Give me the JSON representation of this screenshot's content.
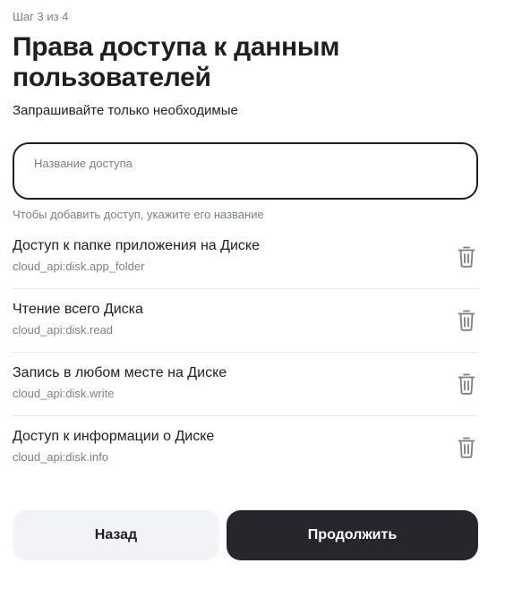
{
  "header": {
    "step": "Шаг 3 из 4",
    "title": "Права доступа к данным пользователей",
    "subtitle": "Запрашивайте только необходимые"
  },
  "access_input": {
    "value": "",
    "placeholder": "Название доступа",
    "hint": "Чтобы добавить доступ, укажите его название"
  },
  "permissions": [
    {
      "title": "Доступ к папке приложения на Диске",
      "scope": "cloud_api:disk.app_folder",
      "icon": "trash-icon"
    },
    {
      "title": "Чтение всего Диска",
      "scope": "cloud_api:disk.read",
      "icon": "trash-icon"
    },
    {
      "title": "Запись в любом месте на Диске",
      "scope": "cloud_api:disk.write",
      "icon": "trash-icon"
    },
    {
      "title": "Доступ к информации о Диске",
      "scope": "cloud_api:disk.info",
      "icon": "trash-icon"
    }
  ],
  "actions": {
    "back_label": "Назад",
    "continue_label": "Продолжить"
  },
  "colors": {
    "text": "#1f1f22",
    "muted": "#7b7f87",
    "primary_button": "#26262c",
    "secondary_button": "#f2f3f6"
  }
}
